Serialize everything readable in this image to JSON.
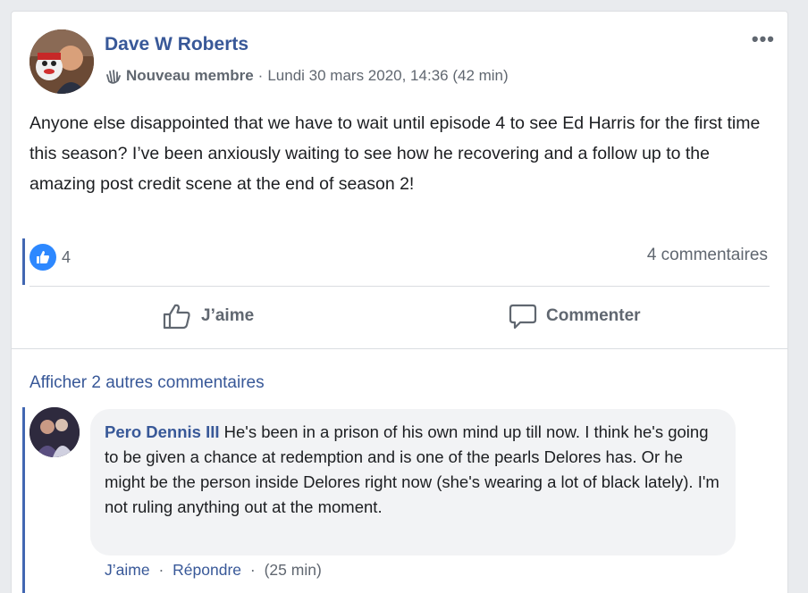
{
  "post": {
    "author": "Dave W Roberts",
    "badge": "Nouveau membre",
    "separator": "·",
    "timestamp": "Lundi 30 mars 2020, 14:36 (42 min)",
    "more_label": "•••",
    "text": "Anyone else disappointed that we have to wait until episode 4 to see Ed Harris for the first time this season? I’ve been anxiously waiting to see how he recovering and a follow up to the amazing post credit scene at the end of season 2!",
    "reaction_count": "4",
    "comments_count": "4 commentaires",
    "like_label": "J’aime",
    "comment_label": "Commenter"
  },
  "comments": {
    "view_more": "Afficher 2 autres commentaires",
    "items": [
      {
        "author": "Pero Dennis III",
        "text": "He's been in a prison of his own mind up till now. I think he's going to be given a chance at redemption and is one of the pearls Delores has. Or he might be the person inside Delores right now (she's wearing a lot of black lately). I'm not ruling anything out at the moment.",
        "like_label": "J’aime",
        "reply_label": "Répondre",
        "separator": "·",
        "time": "(25 min)"
      }
    ]
  },
  "colors": {
    "accent": "#4267b2",
    "link": "#385898",
    "like_badge": "#2d88ff",
    "muted": "#606770"
  },
  "icons": {
    "badge": "waving-hand-icon",
    "reaction": "thumbs-up-icon",
    "like": "thumbs-up-outline-icon",
    "comment": "speech-bubble-icon",
    "more": "more-dots-icon"
  }
}
